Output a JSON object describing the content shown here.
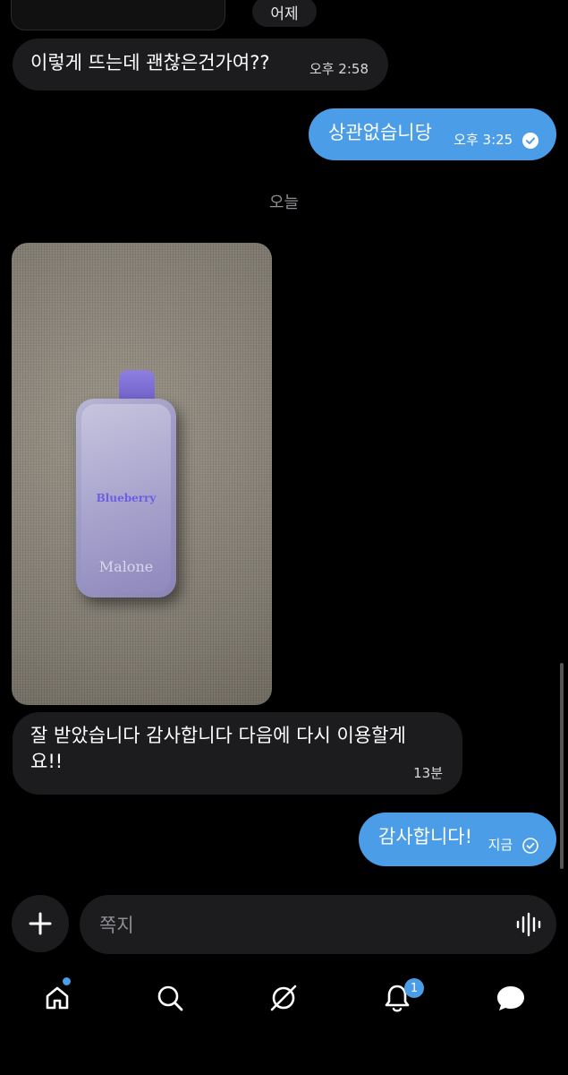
{
  "top": {
    "date_label": "어제"
  },
  "messages": [
    {
      "from": "them",
      "text": "이렇게 뜨는데 괜찮은건가여??",
      "time": "오후 2:58"
    },
    {
      "from": "me",
      "text": "상관없습니당",
      "time": "오후 3:25",
      "read": true
    },
    {
      "day_separator": "오늘"
    },
    {
      "from": "them",
      "type": "photo",
      "photo": {
        "flavor_text": "Blueberry",
        "brand_text": "Malone"
      }
    },
    {
      "from": "them",
      "text": "잘 받았습니다 감사합니다 다음에 다시 이용할게요!!",
      "line1": "잘 받았습니다 감사합니다 다음에 다시 이용할게",
      "line2": "요!!",
      "time": "13분"
    },
    {
      "from": "me",
      "text": "감사합니다!",
      "time": "지금",
      "read": true
    }
  ],
  "composer": {
    "placeholder": "쪽지"
  },
  "nav": {
    "items": [
      "home-icon",
      "search-icon",
      "explore-icon",
      "notifications-icon",
      "messages-icon"
    ],
    "notification_count": "1"
  },
  "colors": {
    "accent": "#4a9de6",
    "incoming_bubble": "#1c1c1e",
    "background": "#000000"
  }
}
